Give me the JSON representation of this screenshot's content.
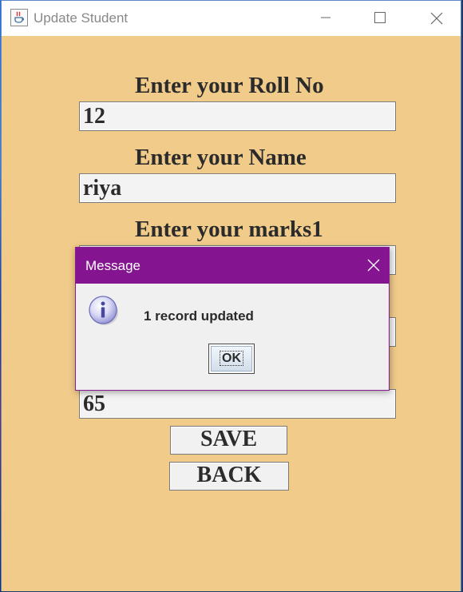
{
  "window": {
    "title": "Update Student",
    "icon": "java-cup-icon"
  },
  "form": {
    "roll_label": "Enter your Roll No",
    "roll_value": "12",
    "name_label": "Enter your Name",
    "name_value": "riya",
    "marks1_label": "Enter your marks1",
    "marks1_value": "",
    "marks2_value": "",
    "marks3_value": "65"
  },
  "buttons": {
    "save": "SAVE",
    "back": "BACK"
  },
  "dialog": {
    "title": "Message",
    "message": "1 record updated",
    "ok": "OK",
    "icon": "info-icon",
    "titlebar_color": "#84148f"
  },
  "colors": {
    "panel_background": "#f0cb8a"
  }
}
